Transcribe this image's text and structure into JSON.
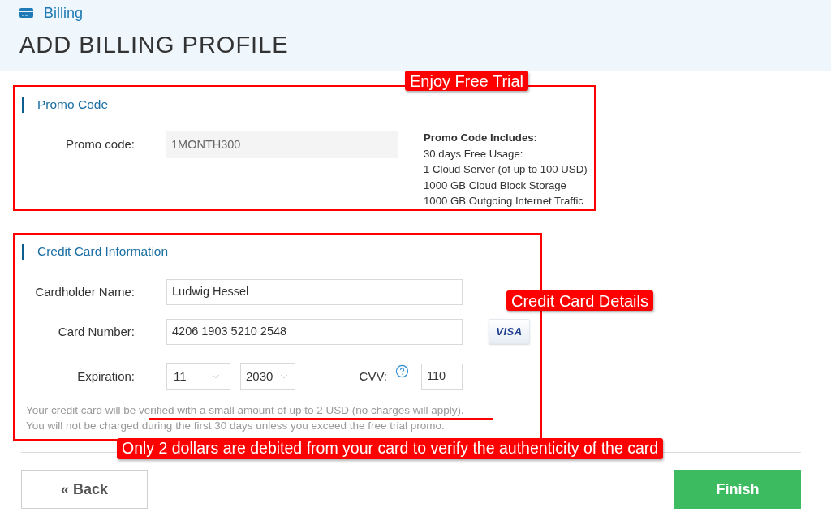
{
  "header": {
    "breadcrumb": "Billing",
    "title": "ADD BILLING PROFILE"
  },
  "promo_section": {
    "title": "Promo Code",
    "annotation": "Enjoy Free Trial",
    "field": {
      "label": "Promo code:",
      "value": "1MONTH300",
      "disabled": true
    },
    "includes": {
      "heading": "Promo Code Includes:",
      "lines": [
        "30 days Free Usage:",
        "1 Cloud Server (of up to 100 USD)",
        "1000 GB Cloud Block Storage",
        "1000 GB Outgoing Internet Traffic"
      ]
    }
  },
  "card_section": {
    "title": "Credit Card Information",
    "annotations": [
      "Credit Card Details",
      "Only 2 dollars are debited from your card to verify the authenticity of the card"
    ],
    "fields": [
      {
        "kind": "text",
        "label": "Cardholder Name:",
        "value": "Ludwig Hessel"
      },
      {
        "kind": "card_number",
        "label": "Card Number:",
        "value": "4206 1903 5210 2548",
        "brand": "VISA"
      },
      {
        "kind": "expiration",
        "label": "Expiration:",
        "month": "11",
        "year": "2030",
        "cvv_label": "CVV:",
        "cvv": "110"
      }
    ],
    "notes": [
      "Your credit card will be verified with a small amount of up to 2 USD (no charges will apply).",
      "You will not be charged during the first 30 days unless you exceed the free trial promo."
    ]
  },
  "buttons": [
    {
      "kind": "secondary",
      "label": "« Back"
    },
    {
      "kind": "primary",
      "label": "Finish"
    }
  ]
}
